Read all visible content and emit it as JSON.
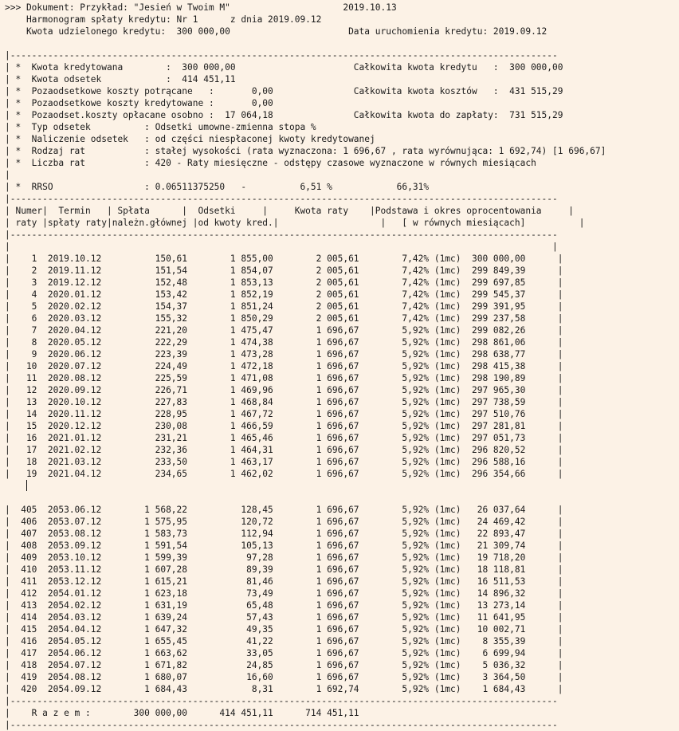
{
  "header": {
    "line1": ">>> Dokument: Przykład: \"Jesień w Twoim M\"                     2019.10.13",
    "line2": "    Harmonogram spłaty kredytu: Nr 1      z dnia 2019.09.12",
    "line3": "    Kwota udzielonego kredytu:  300 000,00                      Data uruchomienia kredytu: 2019.09.12"
  },
  "summary": {
    "rule": "|------------------------------------------------------------------------------------------------------",
    "lines": [
      "| *  Kwota kredytowana        :  300 000,00                      Całkowita kwota kredytu   :  300 000,00",
      "| *  Kwota odsetek            :  414 451,11",
      "| *  Pozaodsetkowe koszty potrącane   :       0,00               Całkowita kwota kosztów   :  431 515,29",
      "| *  Pozaodsetkowe koszty kredytowane :       0,00",
      "| *  Pozaodset.koszty opłacane osobno :  17 064,18               Całkowita kwota do zapłaty:  731 515,29",
      "| *  Typ odsetek          : Odsetki umowne-zmienna stopa %",
      "| *  Naliczenie odsetek   : od części niespłaconej kwoty kredytowanej",
      "| *  Rodzaj rat           : stałej wysokości (rata wyznaczona: 1 696,67 , rata wyrównująca: 1 692,74) [1 696,67]",
      "| *  Liczba rat           : 420 - Raty miesięczne - odstępy czasowe wyznaczone w równych miesiącach",
      "|",
      "| *  RRSO                 : 0.06511375250   -          6,51 %            66,31%"
    ]
  },
  "table": {
    "rule": "|------------------------------------------------------------------------------------------------------",
    "header_line1": "| Numer|  Termin   | Spłata      |  Odsetki     |     Kwota raty    |Podstawa i okres oprocentowania     |",
    "header_line2": "| raty |spłaty raty|należn.głównej |od kwoty kred.|                   |   [ w równych miesiącach]          |",
    "blank_row": "|                                                                                                     |",
    "rows_first": [
      "|    1  2019.10.12          150,61        1 855,00        2 005,61        7,42% (1mc)  300 000,00      |",
      "|    2  2019.11.12          151,54        1 854,07        2 005,61        7,42% (1mc)  299 849,39      |",
      "|    3  2019.12.12          152,48        1 853,13        2 005,61        7,42% (1mc)  299 697,85      |",
      "|    4  2020.01.12          153,42        1 852,19        2 005,61        7,42% (1mc)  299 545,37      |",
      "|    5  2020.02.12          154,37        1 851,24        2 005,61        7,42% (1mc)  299 391,95      |",
      "|    6  2020.03.12          155,32        1 850,29        2 005,61        7,42% (1mc)  299 237,58      |",
      "|    7  2020.04.12          221,20        1 475,47        1 696,67        5,92% (1mc)  299 082,26      |",
      "|    8  2020.05.12          222,29        1 474,38        1 696,67        5,92% (1mc)  298 861,06      |",
      "|    9  2020.06.12          223,39        1 473,28        1 696,67        5,92% (1mc)  298 638,77      |",
      "|   10  2020.07.12          224,49        1 472,18        1 696,67        5,92% (1mc)  298 415,38      |",
      "|   11  2020.08.12          225,59        1 471,08        1 696,67        5,92% (1mc)  298 190,89      |",
      "|   12  2020.09.12          226,71        1 469,96        1 696,67        5,92% (1mc)  297 965,30      |",
      "|   13  2020.10.12          227,83        1 468,84        1 696,67        5,92% (1mc)  297 738,59      |",
      "|   14  2020.11.12          228,95        1 467,72        1 696,67        5,92% (1mc)  297 510,76      |",
      "|   15  2020.12.12          230,08        1 466,59        1 696,67        5,92% (1mc)  297 281,81      |",
      "|   16  2021.01.12          231,21        1 465,46        1 696,67        5,92% (1mc)  297 051,73      |",
      "|   17  2021.02.12          232,36        1 464,31        1 696,67        5,92% (1mc)  296 820,52      |",
      "|   18  2021.03.12          233,50        1 463,17        1 696,67        5,92% (1mc)  296 588,16      |",
      "|   19  2021.04.12          234,65        1 462,02        1 696,67        5,92% (1mc)  296 354,66      |"
    ],
    "rows_last": [
      "|  405  2053.06.12        1 568,22          128,45        1 696,67        5,92% (1mc)   26 037,64      |",
      "|  406  2053.07.12        1 575,95          120,72        1 696,67        5,92% (1mc)   24 469,42      |",
      "|  407  2053.08.12        1 583,73          112,94        1 696,67        5,92% (1mc)   22 893,47      |",
      "|  408  2053.09.12        1 591,54          105,13        1 696,67        5,92% (1mc)   21 309,74      |",
      "|  409  2053.10.12        1 599,39           97,28        1 696,67        5,92% (1mc)   19 718,20      |",
      "|  410  2053.11.12        1 607,28           89,39        1 696,67        5,92% (1mc)   18 118,81      |",
      "|  411  2053.12.12        1 615,21           81,46        1 696,67        5,92% (1mc)   16 511,53      |",
      "|  412  2054.01.12        1 623,18           73,49        1 696,67        5,92% (1mc)   14 896,32      |",
      "|  413  2054.02.12        1 631,19           65,48        1 696,67        5,92% (1mc)   13 273,14      |",
      "|  414  2054.03.12        1 639,24           57,43        1 696,67        5,92% (1mc)   11 641,95      |",
      "|  415  2054.04.12        1 647,32           49,35        1 696,67        5,92% (1mc)   10 002,71      |",
      "|  416  2054.05.12        1 655,45           41,22        1 696,67        5,92% (1mc)    8 355,39      |",
      "|  417  2054.06.12        1 663,62           33,05        1 696,67        5,92% (1mc)    6 699,94      |",
      "|  418  2054.07.12        1 671,82           24,85        1 696,67        5,92% (1mc)    5 036,32      |",
      "|  419  2054.08.12        1 680,07           16,60        1 696,67        5,92% (1mc)    3 364,50      |",
      "|  420  2054.09.12        1 684,43            8,31        1 692,74        5,92% (1mc)    1 684,43      |"
    ],
    "totals": "|    R a z e m :        300 000,00      414 451,11      714 451,11"
  }
}
